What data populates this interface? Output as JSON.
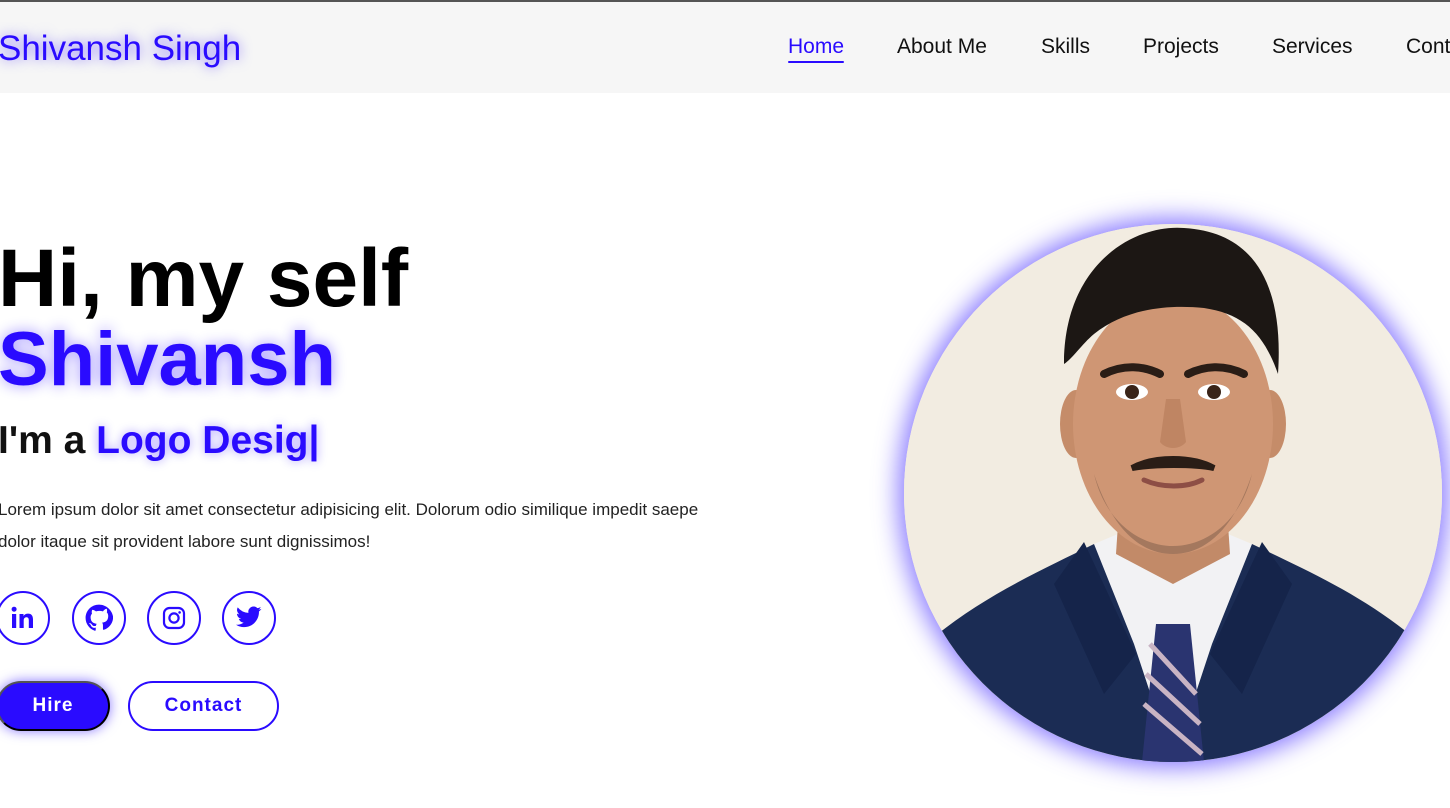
{
  "header": {
    "logo": "Shivansh Singh",
    "nav": [
      {
        "label": "Home",
        "active": true
      },
      {
        "label": "About Me",
        "active": false
      },
      {
        "label": "Skills",
        "active": false
      },
      {
        "label": "Projects",
        "active": false
      },
      {
        "label": "Services",
        "active": false
      },
      {
        "label": "Contact",
        "active": false
      }
    ]
  },
  "hero": {
    "greeting": "Hi, my self",
    "name": "Shivansh",
    "role_prefix": "I'm a ",
    "role_typed": "Logo Desig|",
    "description": "Lorem ipsum dolor sit amet consectetur adipisicing elit. Dolorum odio similique impedit saepe dolor itaque sit provident labore sunt dignissimos!",
    "socials": [
      {
        "icon": "linkedin-icon"
      },
      {
        "icon": "github-icon"
      },
      {
        "icon": "instagram-icon"
      },
      {
        "icon": "twitter-icon"
      }
    ],
    "buttons": {
      "hire": "Hire",
      "contact": "Contact"
    }
  },
  "colors": {
    "accent": "#2a0bff",
    "header_bg": "#f6f6f6",
    "text": "#111111"
  }
}
